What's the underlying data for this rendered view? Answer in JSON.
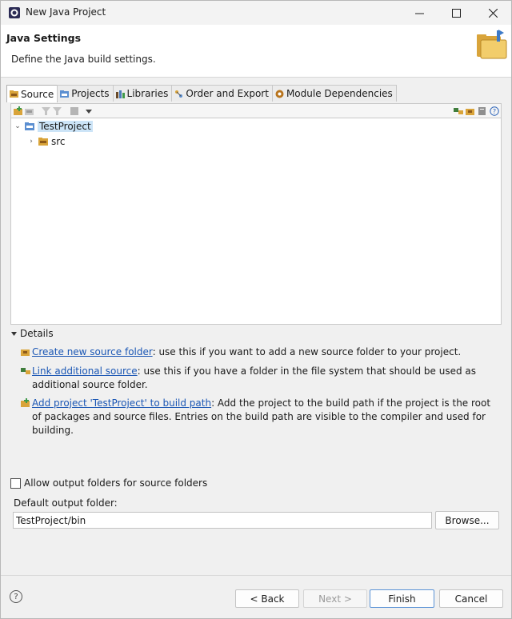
{
  "window": {
    "title": "New Java Project"
  },
  "header": {
    "title": "Java Settings",
    "description": "Define the Java build settings."
  },
  "tabs": [
    {
      "label": "Source",
      "active": true
    },
    {
      "label": "Projects"
    },
    {
      "label": "Libraries"
    },
    {
      "label": "Order and Export"
    },
    {
      "label": "Module Dependencies"
    }
  ],
  "tree": {
    "items": [
      {
        "label": "TestProject",
        "expanded": true
      },
      {
        "label": "src"
      }
    ]
  },
  "details": {
    "heading": "Details",
    "create": {
      "link": "Create new source folder",
      "text": ": use this if you want to add a new source folder to your project."
    },
    "link_source": {
      "link": "Link additional source",
      "text": ": use this if you have a folder in the file system that should be used as additional source folder."
    },
    "add_project": {
      "link": "Add project 'TestProject' to build path",
      "text": ": Add the project to the build path if the project is the root of packages and source files. Entries on the build path are visible to the compiler and used for building."
    }
  },
  "form": {
    "allow_output_label": "Allow output folders for source folders",
    "allow_output_checked": false,
    "default_output_label": "Default output folder:",
    "default_output_value": "TestProject/bin",
    "browse_label": "Browse..."
  },
  "buttons": {
    "back": "< Back",
    "next": "Next >",
    "finish": "Finish",
    "cancel": "Cancel",
    "help": "?"
  },
  "colors": {
    "link": "#1a56b4",
    "selection": "#cce4f7",
    "primary_border": "#5b93d6"
  }
}
